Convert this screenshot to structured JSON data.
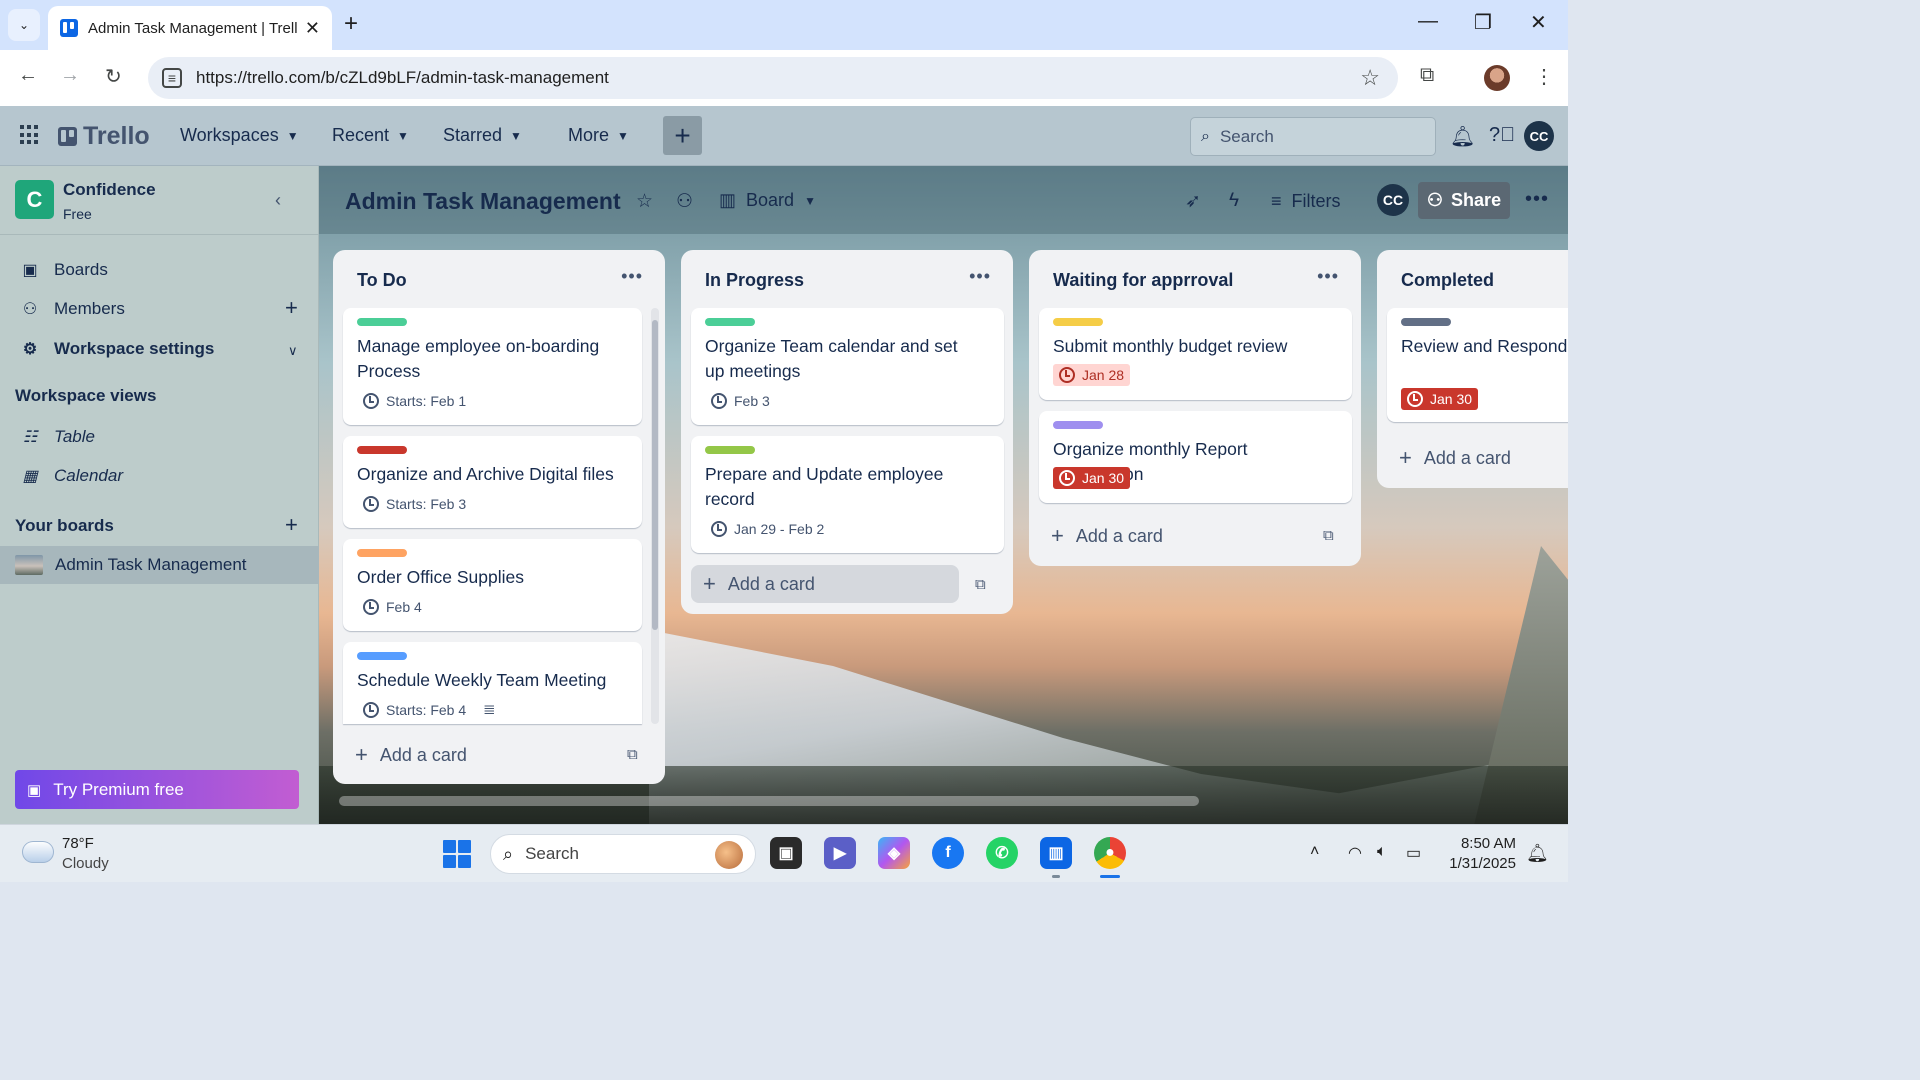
{
  "browser": {
    "tab_title": "Admin Task Management | Trello",
    "new_tab_symbol": "+",
    "url": "https://trello.com/b/cZLd9bLF/admin-task-management"
  },
  "header": {
    "logo_text": "Trello",
    "nav": [
      "Workspaces",
      "Recent",
      "Starred",
      "More"
    ],
    "create_symbol": "+",
    "search_placeholder": "Search",
    "avatar_initials": "CC"
  },
  "sidebar": {
    "workspace_initial": "C",
    "workspace_name": "Confidence",
    "workspace_plan": "Free",
    "items": [
      {
        "label": "Boards",
        "icon": "board-icon"
      },
      {
        "label": "Members",
        "icon": "person-icon"
      },
      {
        "label": "Workspace settings",
        "icon": "gear-icon"
      }
    ],
    "views_heading": "Workspace views",
    "views": [
      {
        "label": "Table",
        "icon": "table-icon"
      },
      {
        "label": "Calendar",
        "icon": "calendar-icon"
      }
    ],
    "boards_heading": "Your boards",
    "active_board": "Admin Task Management",
    "premium_label": "Try Premium free"
  },
  "board": {
    "title": "Admin Task Management",
    "view_label": "Board",
    "filters_label": "Filters",
    "member_initials": "CC",
    "share_label": "Share",
    "lists": [
      {
        "title": "To Do",
        "add_label": "Add a card",
        "cards": [
          {
            "label_color": "#4bce97",
            "title": "Manage employee on-boarding Process",
            "badge": "Starts: Feb 1"
          },
          {
            "label_color": "#c9372c",
            "title": "Organize and Archive Digital files",
            "badge": "Starts: Feb 3"
          },
          {
            "label_color": "#fea362",
            "title": "Order Office Supplies",
            "badge": "Feb 4"
          },
          {
            "label_color": "#579dff",
            "title": "Schedule Weekly Team Meeting",
            "badge": "Starts: Feb 4"
          }
        ]
      },
      {
        "title": "In Progress",
        "add_label": "Add a card",
        "cards": [
          {
            "label_color": "#4bce97",
            "title": "Organize Team calendar and set up meetings",
            "badge": "Feb 3"
          },
          {
            "label_color": "#94c748",
            "title": "Prepare and Update employee record",
            "badge": "Jan 29 - Feb 2"
          }
        ]
      },
      {
        "title": "Waiting for apprroval",
        "add_label": "Add a card",
        "cards": [
          {
            "label_color": "#f5cd47",
            "title": "Submit monthly budget review",
            "badge": "Jan 28"
          },
          {
            "label_color": "#9f8fef",
            "title": "Organize monthly Report Submission",
            "badge": "Jan 30"
          }
        ]
      },
      {
        "title": "Completed",
        "add_label": "Add a card",
        "cards": [
          {
            "label_color": "#626f86",
            "title": "Review and Respond to inquiries",
            "badge": "Jan 30"
          }
        ]
      }
    ]
  },
  "taskbar": {
    "temperature": "78°F",
    "condition": "Cloudy",
    "search_placeholder": "Search",
    "time": "8:50 AM",
    "date": "1/31/2025"
  }
}
